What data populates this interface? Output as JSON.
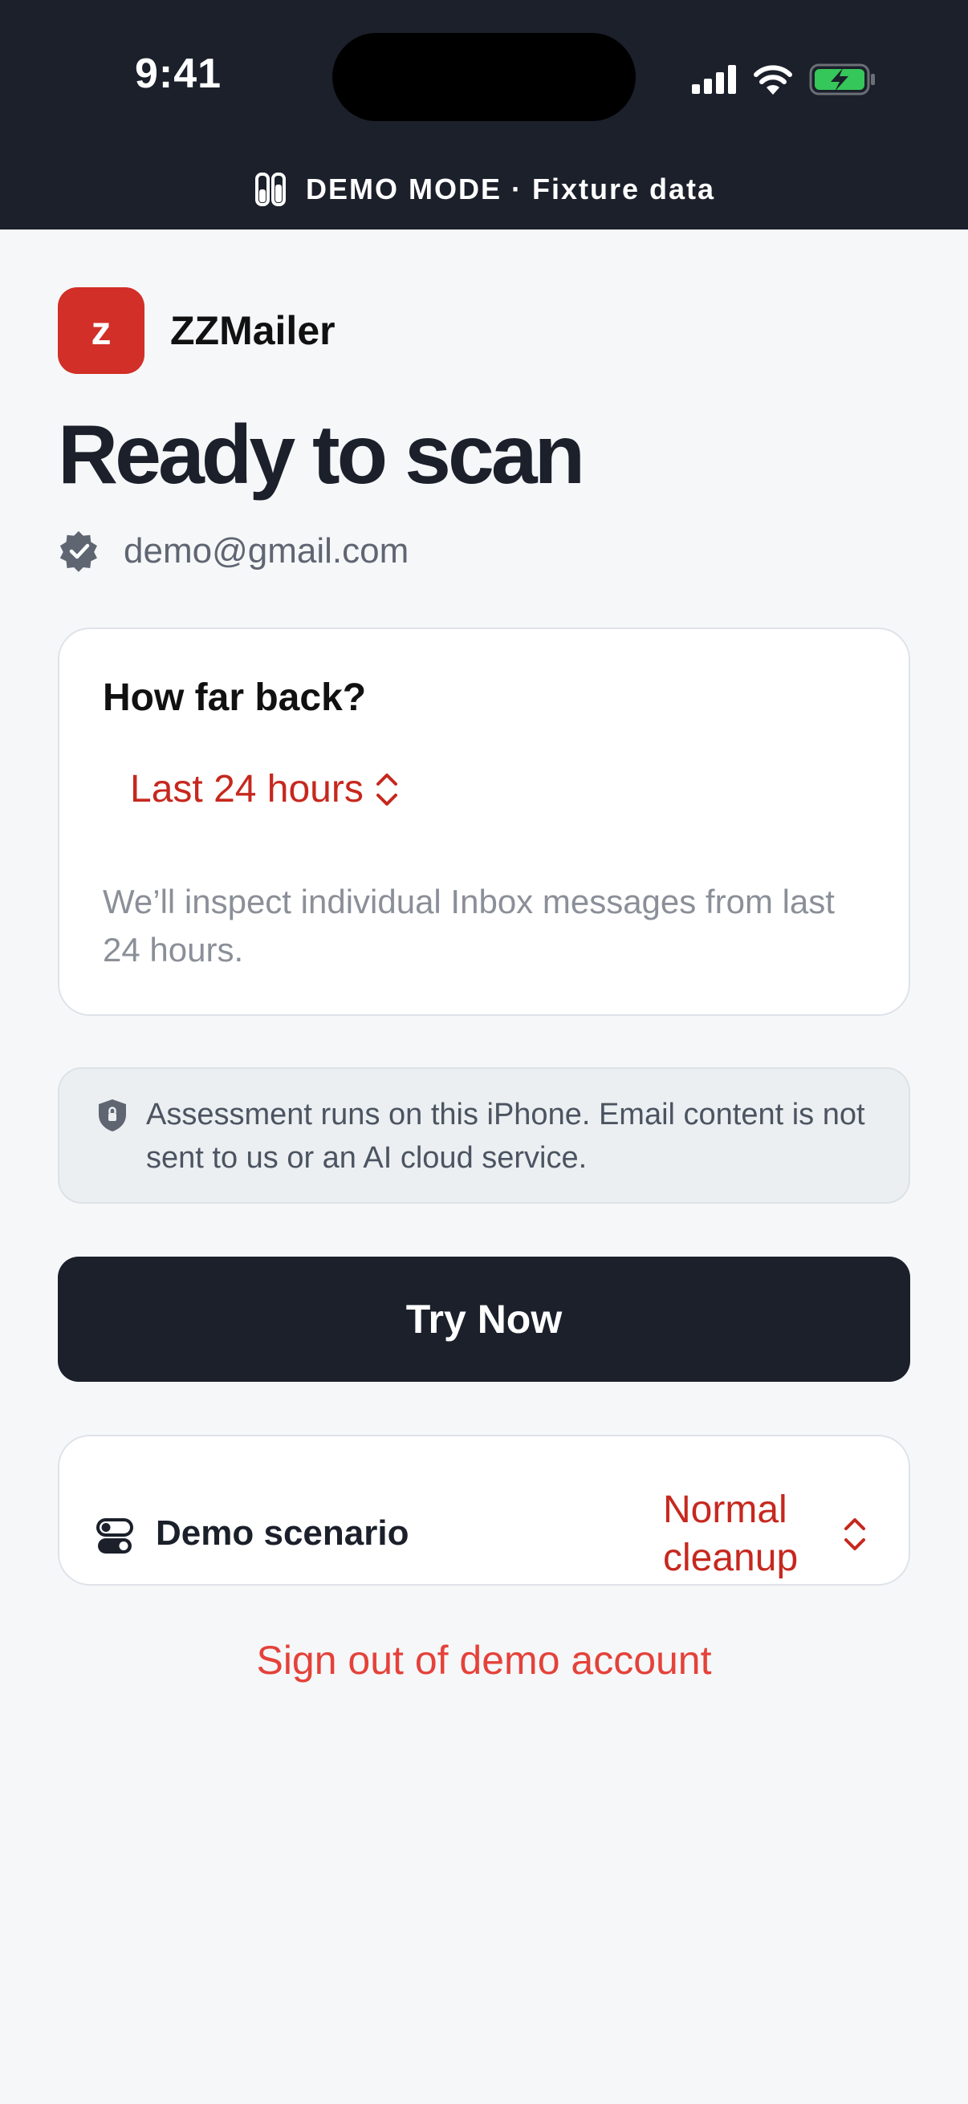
{
  "status_bar": {
    "time": "9:41"
  },
  "banner": {
    "text": "DEMO MODE · Fixture data",
    "icon": "test-tubes-icon"
  },
  "app": {
    "name": "ZZMailer",
    "logo_letter": "z",
    "brand_color": "#d12f27"
  },
  "page": {
    "title": "Ready to scan"
  },
  "account": {
    "email": "demo@gmail.com",
    "icon": "verified-badge-icon"
  },
  "range_card": {
    "title": "How far back?",
    "selected_option": "Last 24 hours",
    "description": "We’ll inspect individual Inbox messages from last 24 hours."
  },
  "privacy": {
    "text": "Assessment runs on this iPhone. Email content is not sent to us or an AI cloud service.",
    "icon": "shield-lock-icon"
  },
  "primary_button": {
    "label": "Try Now"
  },
  "scenario": {
    "label": "Demo scenario",
    "value": "Normal cleanup",
    "icon": "toggles-icon"
  },
  "sign_out": {
    "label": "Sign out of demo account"
  },
  "colors": {
    "dark": "#1b202b",
    "accent": "#c6281e",
    "danger": "#e4423a"
  }
}
